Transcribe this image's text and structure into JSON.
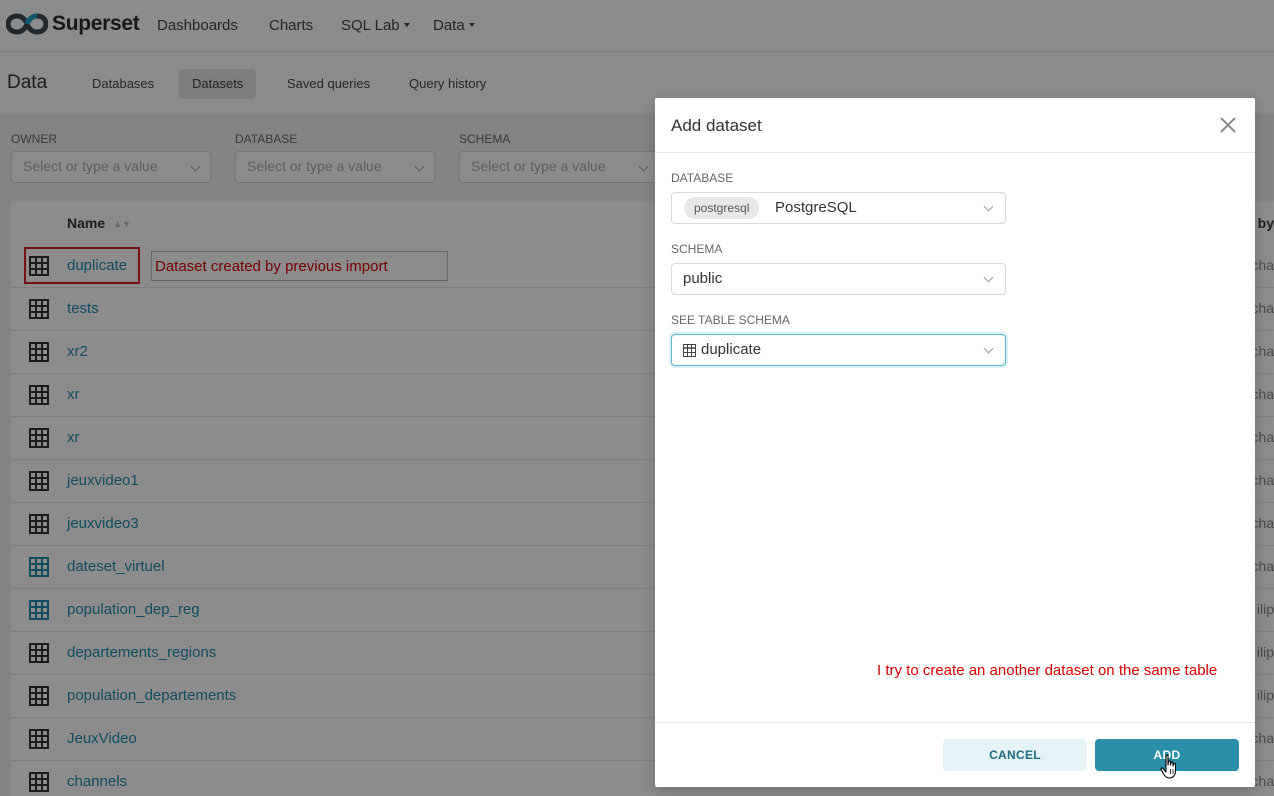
{
  "nav": {
    "brand": "Superset",
    "items": [
      "Dashboards",
      "Charts",
      "SQL Lab",
      "Data"
    ]
  },
  "subheader": {
    "title": "Data",
    "tabs": [
      "Databases",
      "Datasets",
      "Saved queries",
      "Query history"
    ],
    "active_tab": "Datasets"
  },
  "filters": [
    {
      "label": "OWNER",
      "placeholder": "Select or type a value"
    },
    {
      "label": "DATABASE",
      "placeholder": "Select or type a value"
    },
    {
      "label": "SCHEMA",
      "placeholder": "Select or type a value"
    }
  ],
  "table": {
    "header_name": "Name",
    "header_right": "l by",
    "rows": [
      {
        "name": "duplicate",
        "type": "physical",
        "rest": "cha"
      },
      {
        "name": "tests",
        "type": "physical",
        "rest": "cha"
      },
      {
        "name": "xr2",
        "type": "physical",
        "rest": "cha"
      },
      {
        "name": "xr",
        "type": "physical",
        "rest": "cha"
      },
      {
        "name": "xr",
        "type": "physical",
        "rest": "cha"
      },
      {
        "name": "jeuxvideo1",
        "type": "physical",
        "rest": "cha"
      },
      {
        "name": "jeuxvideo3",
        "type": "physical",
        "rest": "cha"
      },
      {
        "name": "dateset_virtuel",
        "type": "virtual",
        "rest": "cha"
      },
      {
        "name": "population_dep_reg",
        "type": "virtual",
        "rest": "ilip"
      },
      {
        "name": "departements_regions",
        "type": "physical",
        "rest": "ilip"
      },
      {
        "name": "population_departements",
        "type": "physical",
        "rest": "ilip"
      },
      {
        "name": "JeuxVideo",
        "type": "physical",
        "rest": "cha"
      },
      {
        "name": "channels",
        "type": "physical",
        "rest": "cha"
      }
    ]
  },
  "annotations": {
    "row_note": "Dataset created by previous import",
    "modal_note": "I try to create an another dataset on the same table"
  },
  "modal": {
    "title": "Add dataset",
    "database_label": "DATABASE",
    "database_badge": "postgresql",
    "database_value": "PostgreSQL",
    "schema_label": "SCHEMA",
    "schema_value": "public",
    "table_label": "SEE TABLE SCHEMA",
    "table_value": "duplicate",
    "cancel_label": "CANCEL",
    "add_label": "ADD"
  },
  "colors": {
    "link": "#1f8ab0",
    "primary": "#20a7c9",
    "annotation": "#d60000"
  }
}
